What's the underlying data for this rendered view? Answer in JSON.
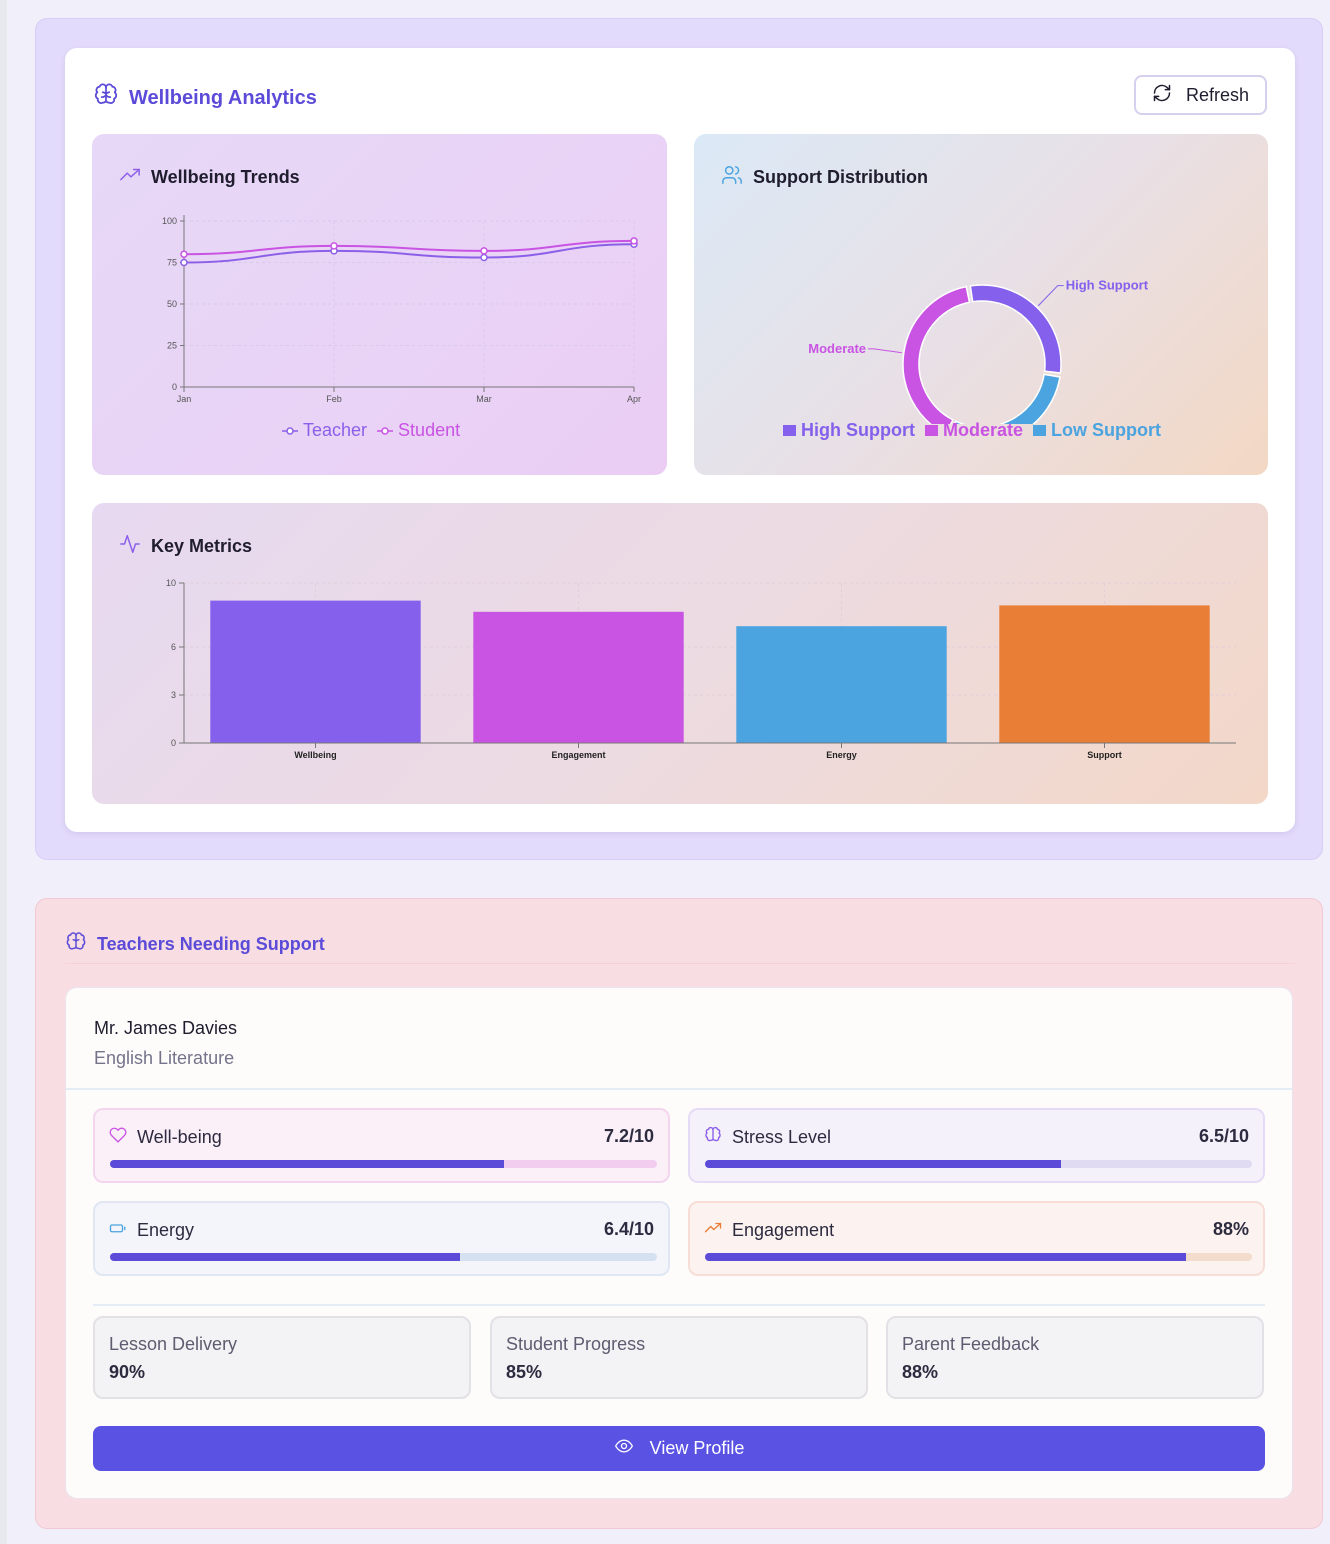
{
  "colors": {
    "accent": "#5b4bd8",
    "teacher": "#8b5fe8",
    "student": "#c953e3",
    "high_support": "#8560ec",
    "moderate": "#c953e3",
    "low_support": "#4ba3df",
    "metric_colors": [
      "#8560ec",
      "#c953e3",
      "#4ba3df",
      "#e97e36"
    ],
    "button": "#5a52e3"
  },
  "analytics": {
    "title": "Wellbeing Analytics",
    "title_icon": "brain-icon",
    "refresh_label": "Refresh",
    "refresh_icon": "refresh-icon"
  },
  "trends": {
    "title": "Wellbeing Trends",
    "icon": "trending-up-icon",
    "legend": [
      "Teacher",
      "Student"
    ]
  },
  "support": {
    "title": "Support Distribution",
    "icon": "users-icon",
    "legend": [
      "High Support",
      "Moderate",
      "Low Support"
    ]
  },
  "metrics": {
    "title": "Key Metrics",
    "icon": "activity-icon"
  },
  "chart_data": [
    {
      "type": "line",
      "categories": [
        "Jan",
        "Feb",
        "Mar",
        "Apr"
      ],
      "series": [
        {
          "name": "Teacher",
          "values": [
            75,
            82,
            78,
            86
          ]
        },
        {
          "name": "Student",
          "values": [
            80,
            85,
            82,
            88
          ]
        }
      ],
      "ylim": [
        0,
        100
      ],
      "yticks": [
        0,
        25,
        50,
        75,
        100
      ],
      "grid": true,
      "legend": "bottom"
    },
    {
      "type": "pie",
      "donut": true,
      "categories": [
        "High Support",
        "Moderate",
        "Low Support"
      ],
      "values": [
        30,
        40,
        30
      ],
      "labels_outside": true,
      "legend": "bottom"
    },
    {
      "type": "bar",
      "categories": [
        "Wellbeing",
        "Engagement",
        "Energy",
        "Support"
      ],
      "values": [
        8.9,
        8.2,
        7.3,
        8.6
      ],
      "ylim": [
        0,
        10
      ],
      "yticks": [
        0,
        3,
        6,
        10
      ],
      "grid": true
    }
  ],
  "teachers_section": {
    "title": "Teachers Needing Support",
    "title_icon": "brain-icon"
  },
  "teacher": {
    "name": "Mr. James Davies",
    "subject": "English Literature",
    "stats": [
      {
        "label": "Well-being",
        "value": "7.2/10",
        "fraction": 0.72,
        "icon": "heart-icon"
      },
      {
        "label": "Stress Level",
        "value": "6.5/10",
        "fraction": 0.65,
        "icon": "brain-icon"
      },
      {
        "label": "Energy",
        "value": "6.4/10",
        "fraction": 0.64,
        "icon": "battery-icon"
      },
      {
        "label": "Engagement",
        "value": "88%",
        "fraction": 0.88,
        "icon": "trending-up-icon"
      }
    ],
    "metrics": [
      {
        "label": "Lesson Delivery",
        "value": "90%"
      },
      {
        "label": "Student Progress",
        "value": "85%"
      },
      {
        "label": "Parent Feedback",
        "value": "88%"
      }
    ],
    "view_profile_label": "View Profile",
    "view_profile_icon": "eye-icon"
  }
}
